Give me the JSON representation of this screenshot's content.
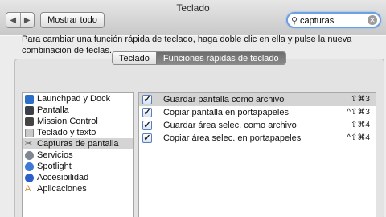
{
  "window": {
    "title": "Teclado"
  },
  "toolbar": {
    "back_label": "◀",
    "forward_label": "▶",
    "show_all_label": "Mostrar todo",
    "search_value": "capturas",
    "search_icon": "magnifier-icon",
    "clear_icon": "clear-icon"
  },
  "tabs": [
    {
      "label": "Teclado",
      "selected": false
    },
    {
      "label": "Funciones rápidas de teclado",
      "selected": true
    }
  ],
  "instructions": "Para cambiar una función rápida de teclado, haga doble clic en ella y pulse la nueva combinación de teclas.",
  "categories": [
    {
      "label": "Launchpad y Dock",
      "icon": "launchpad-dock-icon",
      "color": "#2b6fc7"
    },
    {
      "label": "Pantalla",
      "icon": "display-icon",
      "color": "#3a3f4a"
    },
    {
      "label": "Mission Control",
      "icon": "mission-control-icon",
      "color": "#444444"
    },
    {
      "label": "Teclado y texto",
      "icon": "keyboard-icon",
      "color": "#c9c9c9"
    },
    {
      "label": "Capturas de pantalla",
      "icon": "screenshot-icon",
      "color": "#8a8a8a",
      "selected": true
    },
    {
      "label": "Servicios",
      "icon": "gear-icon",
      "color": "#7f8892"
    },
    {
      "label": "Spotlight",
      "icon": "spotlight-icon",
      "color": "#3f79d6"
    },
    {
      "label": "Accesibilidad",
      "icon": "accessibility-icon",
      "color": "#2d5fc9"
    },
    {
      "label": "Aplicaciones",
      "icon": "applications-icon",
      "color": "#c98f3b"
    }
  ],
  "shortcuts": [
    {
      "checked": true,
      "name": "Guardar pantalla como archivo",
      "keys": "⇧⌘3",
      "selected": true
    },
    {
      "checked": true,
      "name": "Copiar pantalla en portapapeles",
      "keys": "^⇧⌘3"
    },
    {
      "checked": true,
      "name": "Guardar área selec. como archivo",
      "keys": "⇧⌘4"
    },
    {
      "checked": true,
      "name": "Copiar área selec. en portapapeles",
      "keys": "^⇧⌘4"
    }
  ]
}
